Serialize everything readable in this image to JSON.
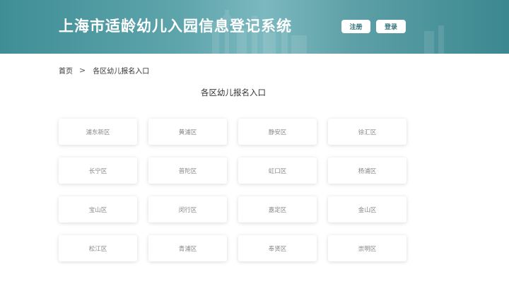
{
  "header": {
    "title": "上海市适龄幼儿入园信息登记系统",
    "register_label": "注册",
    "login_label": "登录"
  },
  "breadcrumb": {
    "home": "首页",
    "separator": ">",
    "current": "各区幼儿报名入口"
  },
  "section": {
    "title": "各区幼儿报名入口"
  },
  "districts": [
    "浦东新区",
    "黄浦区",
    "静安区",
    "徐汇区",
    "长宁区",
    "普陀区",
    "虹口区",
    "杨浦区",
    "宝山区",
    "闵行区",
    "嘉定区",
    "金山区",
    "松江区",
    "青浦区",
    "奉贤区",
    "崇明区"
  ],
  "colors": {
    "header_primary": "#3f8e96",
    "button_text": "#2f6f77",
    "card_text": "#888888"
  }
}
